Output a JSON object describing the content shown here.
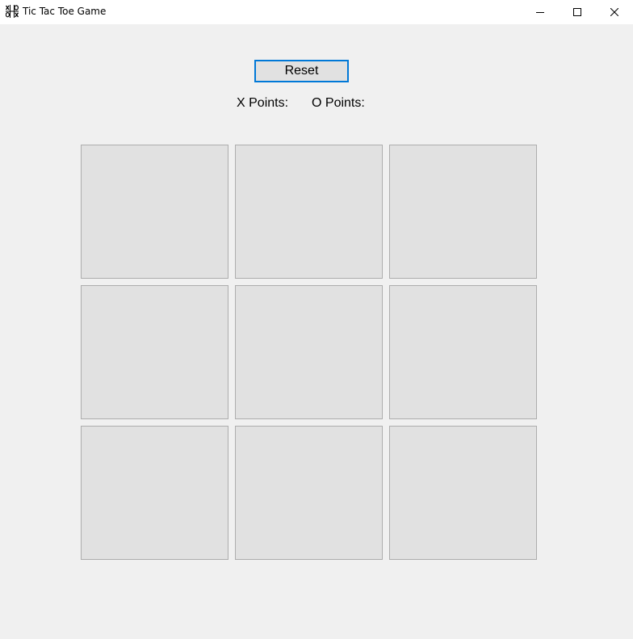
{
  "window": {
    "title": "Tic Tac Toe Game",
    "icon": "tic-tac-toe-icon",
    "controls": {
      "minimize_icon": "minimize-icon",
      "maximize_icon": "maximize-icon",
      "close_icon": "close-icon"
    }
  },
  "toolbar": {
    "reset_label": "Reset"
  },
  "score": {
    "x_points_label": "X Points:",
    "o_points_label": "O Points:"
  },
  "board": {
    "cells": [
      "",
      "",
      "",
      "",
      "",
      "",
      "",
      "",
      ""
    ]
  },
  "colors": {
    "background": "#f0f0f0",
    "titlebar": "#ffffff",
    "button_face": "#e1e1e1",
    "focus_border": "#0078d7",
    "cell_border": "#adadad"
  }
}
